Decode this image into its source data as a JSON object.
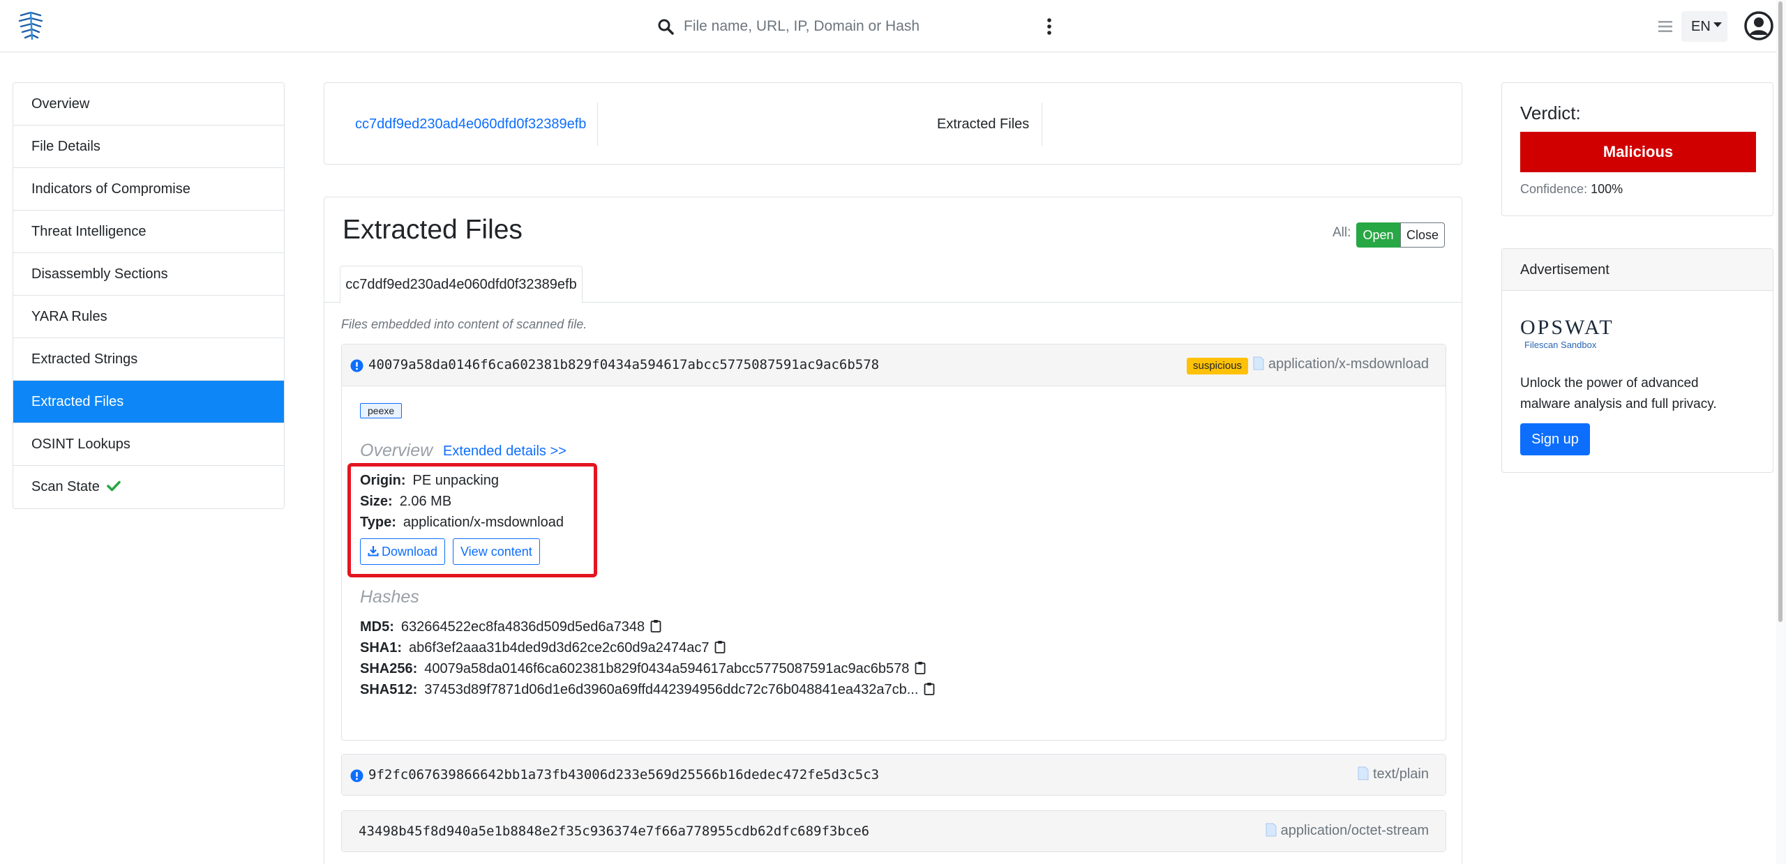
{
  "header": {
    "search_placeholder": "File name, URL, IP, Domain or Hash",
    "language": "EN"
  },
  "sidebar": {
    "items": [
      {
        "label": "Overview"
      },
      {
        "label": "File Details"
      },
      {
        "label": "Indicators of Compromise"
      },
      {
        "label": "Threat Intelligence"
      },
      {
        "label": "Disassembly Sections"
      },
      {
        "label": "YARA Rules"
      },
      {
        "label": "Extracted Strings"
      },
      {
        "label": "Extracted Files",
        "active": true
      },
      {
        "label": "OSINT Lookups"
      },
      {
        "label": "Scan State"
      }
    ]
  },
  "breadcrumb": {
    "parent": "cc7ddf9ed230ad4e060dfd0f32389efb",
    "current": "Extracted Files"
  },
  "main": {
    "title": "Extracted Files",
    "all_label": "All:",
    "open_label": "Open",
    "close_label": "Close",
    "tab_label": "cc7ddf9ed230ad4e060dfd0f32389efb",
    "embed_note": "Files embedded into content of scanned file."
  },
  "files": [
    {
      "hash": "40079a58da0146f6ca602381b829f0434a594617abcc5775087591ac9ac6b578",
      "badge": "suspicious",
      "mime": "application/x-msdownload",
      "tag": "peexe",
      "overview_title": "Overview",
      "extended_link": "Extended details >>",
      "origin_label": "Origin:",
      "origin": "PE unpacking",
      "size_label": "Size:",
      "size": "2.06 MB",
      "type_label": "Type:",
      "type": "application/x-msdownload",
      "download_label": "Download",
      "view_label": "View content",
      "hashes_title": "Hashes",
      "md5_label": "MD5:",
      "md5": "632664522ec8fa4836d509d5ed6a7348",
      "sha1_label": "SHA1:",
      "sha1": "ab6f3ef2aaa31b4ded9d3d62ce2c60d9a2474ac7",
      "sha256_label": "SHA256:",
      "sha256": "40079a58da0146f6ca602381b829f0434a594617abcc5775087591ac9ac6b578",
      "sha512_label": "SHA512:",
      "sha512": "37453d89f7871d06d1e6d3960a69ffd442394956ddc72c76b048841ea432a7cb..."
    },
    {
      "hash": "9f2fc067639866642bb1a73fb43006d233e569d25566b16dedec472fe5d3c5c3",
      "mime": "text/plain"
    },
    {
      "hash": "43498b45f8d940a5e1b8848e2f35c936374e7f66a778955cdb62dfc689f3bce6",
      "mime": "application/octet-stream"
    }
  ],
  "verdict": {
    "label": "Verdict:",
    "value": "Malicious",
    "confidence_label": "Confidence:",
    "confidence_value": "100%"
  },
  "ad": {
    "header": "Advertisement",
    "brand": "OPSWAT",
    "brand_sub": "Filescan Sandbox",
    "text": "Unlock the power of advanced malware analysis and full privacy.",
    "cta": "Sign up"
  },
  "colors": {
    "accent": "#0d87f7",
    "malicious": "#d10000",
    "suspicious": "#ffc107",
    "open_green": "#28a745",
    "highlight_box": "#e3151f"
  }
}
